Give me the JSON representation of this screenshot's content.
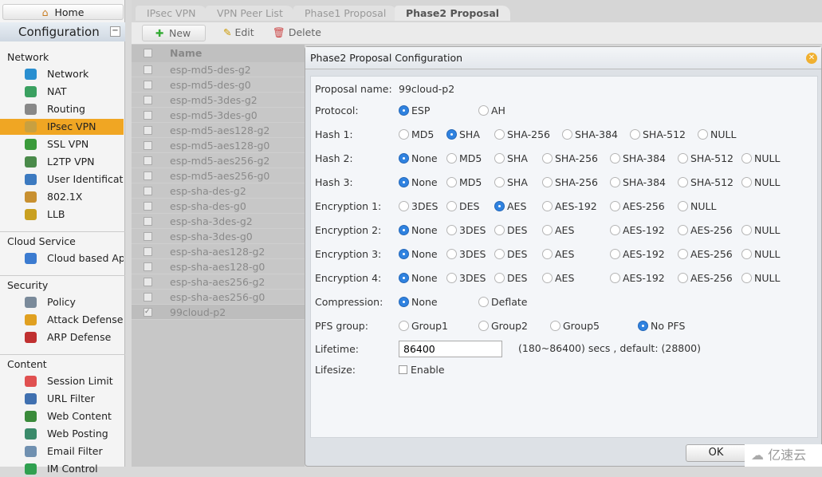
{
  "sidebar": {
    "home": "Home",
    "configuration": "Configuration",
    "collapse": "−",
    "sections": [
      {
        "title": "Network",
        "items": [
          "Network",
          "NAT",
          "Routing",
          "IPsec VPN",
          "SSL VPN",
          "L2TP VPN",
          "User Identification",
          "802.1X",
          "LLB"
        ]
      },
      {
        "title": "Cloud Service",
        "items": [
          "Cloud based App"
        ]
      },
      {
        "title": "Security",
        "items": [
          "Policy",
          "Attack Defense",
          "ARP Defense"
        ]
      },
      {
        "title": "Content",
        "items": [
          "Session Limit",
          "URL Filter",
          "Web Content",
          "Web Posting",
          "Email Filter",
          "IM Control"
        ]
      }
    ],
    "active": "IPsec VPN"
  },
  "tabs": [
    "IPsec VPN",
    "VPN Peer List",
    "Phase1 Proposal",
    "Phase2 Proposal"
  ],
  "active_tab": "Phase2 Proposal",
  "toolbar": {
    "new": "New",
    "edit": "Edit",
    "delete": "Delete"
  },
  "grid": {
    "header": "Name",
    "rows": [
      "esp-md5-des-g2",
      "esp-md5-des-g0",
      "esp-md5-3des-g2",
      "esp-md5-3des-g0",
      "esp-md5-aes128-g2",
      "esp-md5-aes128-g0",
      "esp-md5-aes256-g2",
      "esp-md5-aes256-g0",
      "esp-sha-des-g2",
      "esp-sha-des-g0",
      "esp-sha-3des-g2",
      "esp-sha-3des-g0",
      "esp-sha-aes128-g2",
      "esp-sha-aes128-g0",
      "esp-sha-aes256-g2",
      "esp-sha-aes256-g0",
      "99cloud-p2"
    ],
    "checked": "99cloud-p2"
  },
  "dialog": {
    "title": "Phase2 Proposal Configuration",
    "proposal_name_label": "Proposal name:",
    "proposal_name": "99cloud-p2",
    "rows": [
      {
        "label": "Protocol:",
        "options": [
          "ESP",
          "AH"
        ],
        "selected": "ESP"
      },
      {
        "label": "Hash 1:",
        "options": [
          "MD5",
          "SHA",
          "SHA-256",
          "SHA-384",
          "SHA-512",
          "NULL"
        ],
        "selected": "SHA"
      },
      {
        "label": "Hash 2:",
        "options": [
          "None",
          "MD5",
          "SHA",
          "SHA-256",
          "SHA-384",
          "SHA-512",
          "NULL"
        ],
        "selected": "None"
      },
      {
        "label": "Hash 3:",
        "options": [
          "None",
          "MD5",
          "SHA",
          "SHA-256",
          "SHA-384",
          "SHA-512",
          "NULL"
        ],
        "selected": "None"
      },
      {
        "label": "Encryption 1:",
        "options": [
          "3DES",
          "DES",
          "AES",
          "AES-192",
          "AES-256",
          "NULL"
        ],
        "selected": "AES"
      },
      {
        "label": "Encryption 2:",
        "options": [
          "None",
          "3DES",
          "DES",
          "AES",
          "AES-192",
          "AES-256",
          "NULL"
        ],
        "selected": "None"
      },
      {
        "label": "Encryption 3:",
        "options": [
          "None",
          "3DES",
          "DES",
          "AES",
          "AES-192",
          "AES-256",
          "NULL"
        ],
        "selected": "None"
      },
      {
        "label": "Encryption 4:",
        "options": [
          "None",
          "3DES",
          "DES",
          "AES",
          "AES-192",
          "AES-256",
          "NULL"
        ],
        "selected": "None"
      },
      {
        "label": "Compression:",
        "options": [
          "None",
          "Deflate"
        ],
        "selected": "None"
      },
      {
        "label": "PFS group:",
        "options": [
          "Group1",
          "Group2",
          "Group5",
          "No PFS"
        ],
        "selected": "No PFS"
      }
    ],
    "lifetime_label": "Lifetime:",
    "lifetime": "86400",
    "lifetime_hint": "(180~86400) secs , default: (28800)",
    "lifesize_label": "Lifesize:",
    "lifesize_enable": "Enable",
    "lifesize_checked": false,
    "ok": "OK"
  },
  "watermark": "亿速云"
}
